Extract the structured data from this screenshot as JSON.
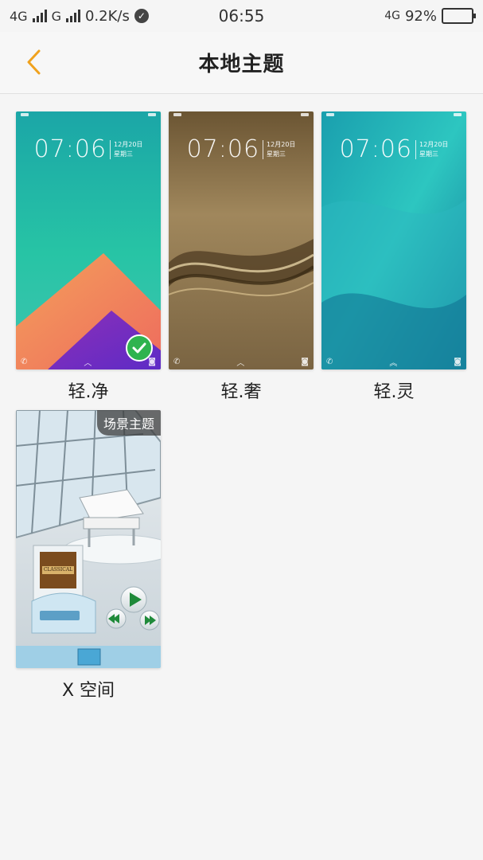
{
  "status_bar": {
    "network1": "4G",
    "network2": "G",
    "speed": "0.2K/s",
    "time": "06:55",
    "network_right": "4G",
    "battery_text": "92%",
    "battery_level": 0.92
  },
  "header": {
    "title": "本地主题"
  },
  "lock_clock": {
    "time": "07:06",
    "date": "12月20日",
    "weekday": "星期三"
  },
  "themes": [
    {
      "name": "轻.净",
      "applied": true
    },
    {
      "name": "轻.奢",
      "applied": false
    },
    {
      "name": "轻.灵",
      "applied": false
    },
    {
      "name": "X 空间",
      "applied": false,
      "badge": "场景主题",
      "album_text": "CLASSICAL"
    }
  ],
  "colors": {
    "accent": "#f0a21e",
    "applied_green": "#2fb34f"
  }
}
